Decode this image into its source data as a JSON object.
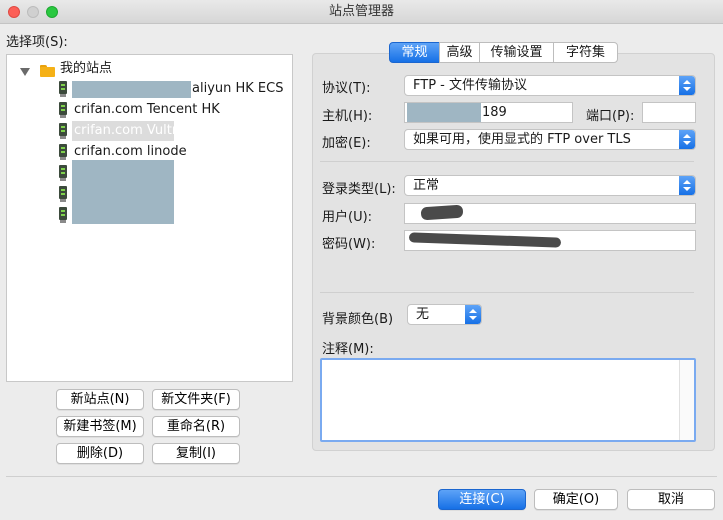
{
  "window": {
    "title": "站点管理器"
  },
  "left": {
    "label": "选择项(S):",
    "tree": {
      "root": "我的站点",
      "sites": [
        {
          "name": "aliyun HK ECS"
        },
        {
          "name": "crifan.com Tencent HK"
        },
        {
          "name": "crifan.com Vultr"
        },
        {
          "name": "crifan.com linode"
        }
      ]
    },
    "buttons": {
      "new_site": "新站点(N)",
      "new_folder": "新文件夹(F)",
      "new_bookmark": "新建书签(M)",
      "rename": "重命名(R)",
      "delete": "删除(D)",
      "copy": "复制(I)"
    }
  },
  "tabs": [
    "常规",
    "高级",
    "传输设置",
    "字符集"
  ],
  "general": {
    "protocol_label": "协议(T):",
    "protocol_value": "FTP - 文件传输协议",
    "host_label": "主机(H):",
    "host_value": "189",
    "port_label": "端口(P):",
    "port_value": "",
    "encryption_label": "加密(E):",
    "encryption_value": "如果可用，使用显式的 FTP over TLS",
    "logon_type_label": "登录类型(L):",
    "logon_type_value": "正常",
    "user_label": "用户(U):",
    "password_label": "密码(W):",
    "bg_color_label": "背景颜色(B)",
    "bg_color_value": "无",
    "comments_label": "注释(M):"
  },
  "footer": {
    "connect": "连接(C)",
    "ok": "确定(O)",
    "cancel": "取消"
  }
}
